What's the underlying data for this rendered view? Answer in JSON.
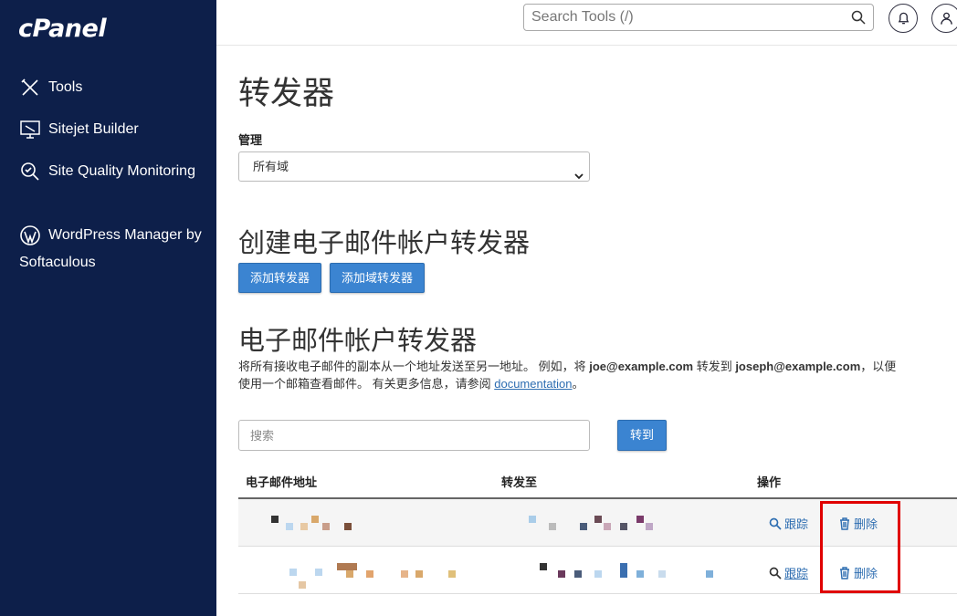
{
  "brand": {
    "logo": "cPanel"
  },
  "sidebar": {
    "items": [
      {
        "label": "Tools",
        "icon": "tools-icon"
      },
      {
        "label": "Sitejet Builder",
        "icon": "sitejet-icon"
      },
      {
        "label": "Site Quality Monitoring",
        "icon": "site-quality-icon"
      },
      {
        "label": "WordPress Manager by Softaculous",
        "icon": "wordpress-icon"
      }
    ]
  },
  "topbar": {
    "search_placeholder": "Search Tools (/)",
    "notifications_icon": "bell-icon",
    "user_icon": "user-icon"
  },
  "page": {
    "title": "转发器",
    "manage_label": "管理",
    "domain_select_value": "所有域",
    "create_heading": "创建电子邮件帐户转发器",
    "add_forwarder_label": "添加转发器",
    "add_domain_forwarder_label": "添加域转发器",
    "email_forwarders_heading": "电子邮件帐户转发器",
    "desc_part1": "将所有接收电子邮件的副本从一个地址发送至另一地址。 例如，将 ",
    "desc_email1": "joe@example.com",
    "desc_part2": " 转发到 ",
    "desc_email2": "joseph@example.com",
    "desc_part3": "，以便",
    "desc_line2_text": "使用一个邮箱查看邮件。 有关更多信息，请参阅 ",
    "desc_link": "documentation",
    "desc_end": "。",
    "filter_placeholder": "搜索",
    "go_label": "转到"
  },
  "table": {
    "headers": [
      "电子邮件地址",
      "转发至",
      "操作"
    ],
    "rows": [
      {
        "trace_label": "跟踪",
        "delete_label": "删除"
      },
      {
        "trace_label": "跟踪",
        "delete_label": "删除"
      }
    ]
  },
  "colors": {
    "sidebar_bg": "#0d1f4a",
    "primary_button": "#3b84d1",
    "link": "#2d6db1",
    "highlight_box": "#e00000"
  }
}
